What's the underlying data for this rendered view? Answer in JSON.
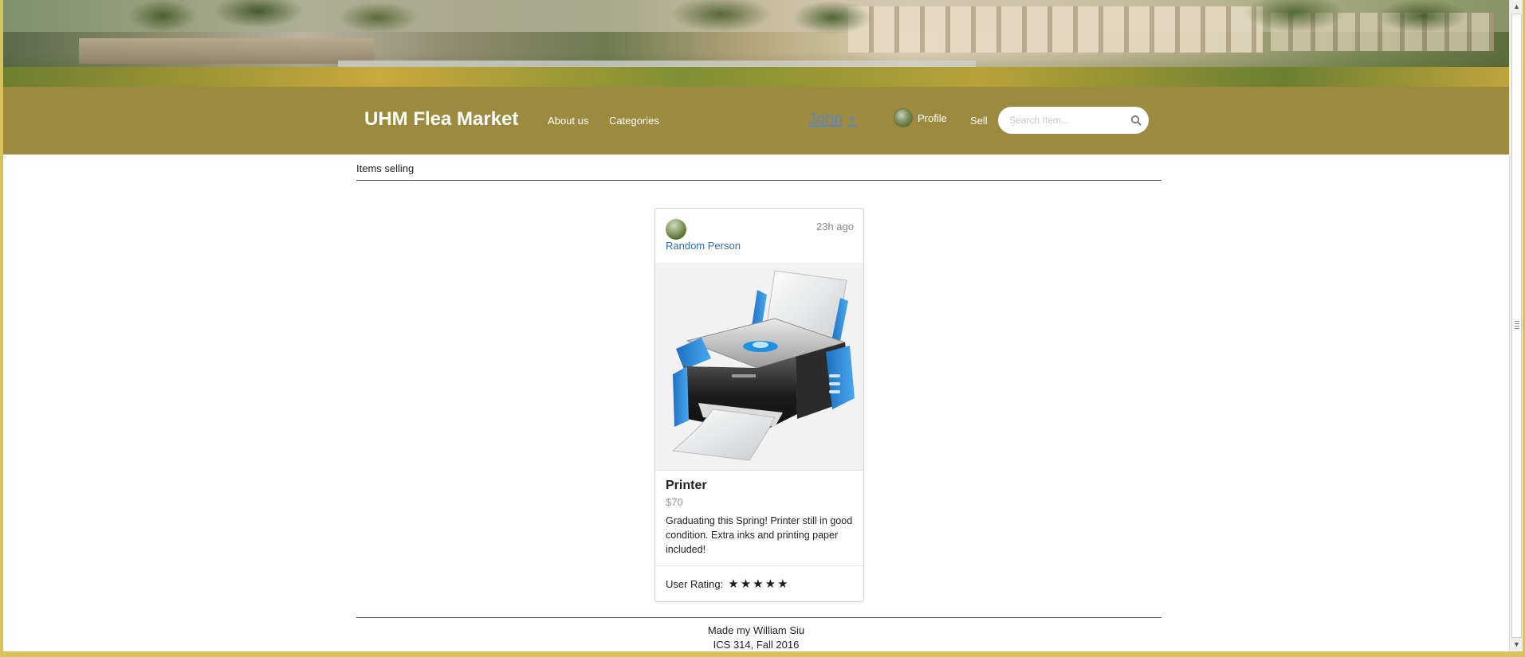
{
  "navbar": {
    "brand": "UHM Flea Market",
    "links": {
      "about": "About us",
      "categories": "Categories",
      "user": "John",
      "profile": "Profile",
      "sell": "Sell"
    },
    "search": {
      "placeholder": "Search Item...",
      "value": ""
    }
  },
  "section": {
    "title": "Items selling"
  },
  "listing": {
    "seller": "Random Person",
    "time": "23h ago",
    "title": "Printer",
    "price": "$70",
    "description": "Graduating this Spring! Printer still in good condition. Extra inks and printing paper included!",
    "rating_label": "User Rating:",
    "rating": 5,
    "rating_max": 5
  },
  "footer": {
    "line1": "Made my William Siu",
    "line2": "ICS 314, Fall 2016"
  },
  "colors": {
    "navbar_bg": "#9c8b3e",
    "link_blue": "#2f6db5",
    "user_link": "#5a86c6",
    "printer_blue": "#2a86d8"
  },
  "icons": {
    "search": "search-icon",
    "caret": "caret-down-icon",
    "star": "star-icon"
  }
}
